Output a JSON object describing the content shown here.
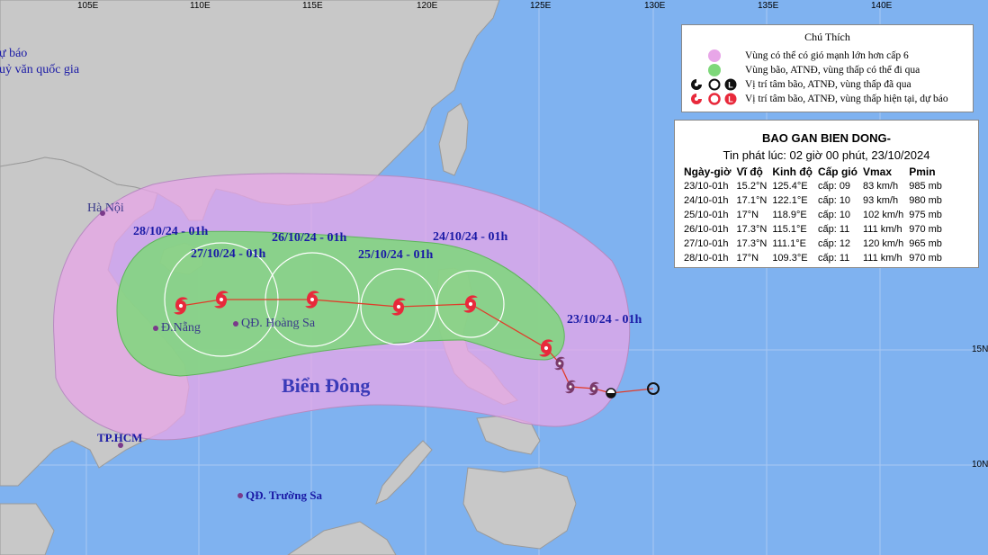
{
  "map": {
    "lat_ticks": [
      "15N",
      "10N"
    ],
    "lon_ticks": [
      "105E",
      "110E",
      "115E",
      "120E",
      "125E",
      "130E",
      "135E",
      "140E"
    ],
    "partial_top_left": [
      "dự báo",
      "huỷ văn quốc gia"
    ],
    "sea_label": "Biển Đông",
    "places": [
      {
        "name": "Hà Nội",
        "color": "#3a3a8a"
      },
      {
        "name": "Đ.Nẵng",
        "color": "#3a3a8a"
      },
      {
        "name": "QĐ. Hoàng Sa",
        "color": "#3a3a8a"
      },
      {
        "name": "TP.HCM",
        "color": "#1a1aa6"
      },
      {
        "name": "QĐ. Trường Sa",
        "color": "#1a1aa6"
      }
    ],
    "forecast_labels": [
      "28/10/24 - 01h",
      "27/10/24 - 01h",
      "26/10/24 - 01h",
      "25/10/24 - 01h",
      "24/10/24 - 01h",
      "23/10/24 - 01h"
    ],
    "colors": {
      "sea": "#7fb2f0",
      "land": "#c8c8c8",
      "strong_wind_zone": "#e8a6e8",
      "storm_zone": "#7ed87a",
      "track_line": "#e03c2a",
      "current_storm": "#e8293b",
      "past_storm": "#7a3a6a"
    }
  },
  "legend": {
    "title": "Chú Thích",
    "items": [
      {
        "symbol": "pink-dot",
        "text": "Vùng có thể có gió mạnh lớn hơn cấp 6"
      },
      {
        "symbol": "green-dot",
        "text": "Vùng bão, ATNĐ, vùng thấp có thể đi qua"
      },
      {
        "symbol": "black-storm-icons",
        "text": "Vị trí tâm bão, ATNĐ, vùng thấp đã qua"
      },
      {
        "symbol": "red-storm-icons",
        "text": "Vị trí tâm bão, ATNĐ, vùng thấp hiện tại, dự báo"
      }
    ]
  },
  "info": {
    "title": "BAO GAN BIEN DONG-",
    "issued": "Tin phát lúc: 02 giờ 00 phút, 23/10/2024",
    "headers": [
      "Ngày-giờ",
      "Vĩ độ",
      "Kinh độ",
      "Cấp gió",
      "Vmax",
      "Pmin"
    ],
    "rows": [
      [
        "23/10-01h",
        "15.2°N",
        "125.4°E",
        "cấp: 09",
        "83 km/h",
        "985 mb"
      ],
      [
        "24/10-01h",
        "17.1°N",
        "122.1°E",
        "cấp: 10",
        "93 km/h",
        "980 mb"
      ],
      [
        "25/10-01h",
        "17°N",
        "118.9°E",
        "cấp: 10",
        "102 km/h",
        "975 mb"
      ],
      [
        "26/10-01h",
        "17.3°N",
        "115.1°E",
        "cấp: 11",
        "111 km/h",
        "970 mb"
      ],
      [
        "27/10-01h",
        "17.3°N",
        "111.1°E",
        "cấp: 12",
        "120 km/h",
        "965 mb"
      ],
      [
        "28/10-01h",
        "17°N",
        "109.3°E",
        "cấp: 11",
        "111 km/h",
        "970 mb"
      ]
    ]
  }
}
